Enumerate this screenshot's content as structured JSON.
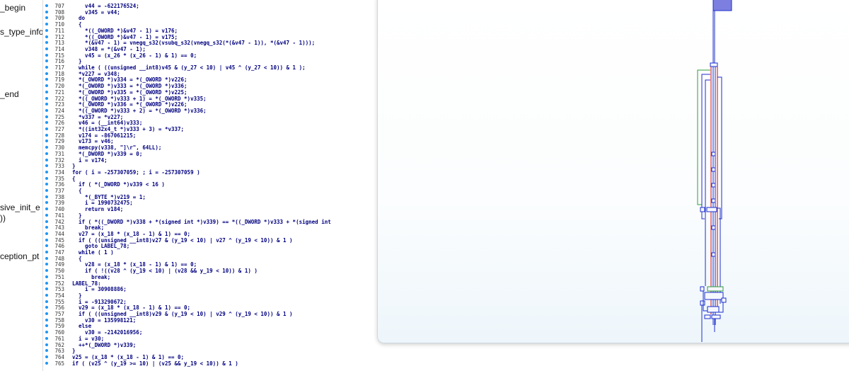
{
  "function_list": [
    {
      "label": "_begin"
    },
    {
      "label": "s_type_info"
    },
    {
      "label": "_end"
    },
    {
      "label": "sive_init_e"
    },
    {
      "label": "))"
    },
    {
      "label": "ception_pt"
    }
  ],
  "code_lines": [
    {
      "ln": "707",
      "text": "    v44 = -622176524;"
    },
    {
      "ln": "708",
      "text": "    v345 = v44;"
    },
    {
      "ln": "709",
      "text": "  do"
    },
    {
      "ln": "710",
      "text": "  {"
    },
    {
      "ln": "711",
      "text": "    *((_OWORD *)&v47 - 1) = v176;"
    },
    {
      "ln": "712",
      "text": "    *((_OWORD *)&v47 - 1) = v175;"
    },
    {
      "ln": "713",
      "text": "    *(&v47 - 1) = vnegq_s32(vsubq_s32(vnegq_s32(*(&v47 - 1)), *(&v47 - 1)));"
    },
    {
      "ln": "714",
      "text": "    v348 = *(&v47 - 1);"
    },
    {
      "ln": "715",
      "text": "    v45 = (x_26 * (x_26 - 1) & 1) == 0;"
    },
    {
      "ln": "716",
      "text": "  }"
    },
    {
      "ln": "717",
      "text": "  while ( ((unsigned __int8)v45 & (y_27 < 10) | v45 ^ (y_27 < 10)) & 1 );"
    },
    {
      "ln": "718",
      "text": "  *v227 = v348;"
    },
    {
      "ln": "719",
      "text": "  *(_OWORD *)v334 = *(_OWORD *)v226;"
    },
    {
      "ln": "720",
      "text": "  *(_OWORD *)v333 = *(_OWORD *)v336;"
    },
    {
      "ln": "721",
      "text": "  *(_OWORD *)v335 = *(_OWORD *)v225;"
    },
    {
      "ln": "722",
      "text": "  *((_OWORD *)v333 + 1) = *(_OWORD *)v335;"
    },
    {
      "ln": "723",
      "text": "  *(_OWORD *)v336 = *(_OWORD *)v226;"
    },
    {
      "ln": "724",
      "text": "  *((_OWORD *)v333 + 2) = *(_OWORD *)v336;"
    },
    {
      "ln": "725",
      "text": "  *v337 = *v227;"
    },
    {
      "ln": "726",
      "text": "  v46 = (__int64)v333;"
    },
    {
      "ln": "727",
      "text": "  *((int32x4_t *)v333 + 3) = *v337;"
    },
    {
      "ln": "728",
      "text": "  v174 = -867061215;"
    },
    {
      "ln": "729",
      "text": "  v173 = v46;"
    },
    {
      "ln": "730",
      "text": "  memcpy(v338, \"]\\r\", 64LL);"
    },
    {
      "ln": "731",
      "text": "  *(_DWORD *)v339 = 0;"
    },
    {
      "ln": "732",
      "text": "  i = v174;"
    },
    {
      "ln": "733",
      "text": "}"
    },
    {
      "ln": "734",
      "text": "for ( i = -257307059; ; i = -257307059 )"
    },
    {
      "ln": "735",
      "text": "{"
    },
    {
      "ln": "736",
      "text": "  if ( *(_DWORD *)v339 < 16 )"
    },
    {
      "ln": "737",
      "text": "  {"
    },
    {
      "ln": "738",
      "text": "    *(_BYTE *)v219 = 1;"
    },
    {
      "ln": "739",
      "text": "    i = 1990732475;"
    },
    {
      "ln": "740",
      "text": "    return v184;"
    },
    {
      "ln": "741",
      "text": "  }"
    },
    {
      "ln": "742",
      "text": "  if ( *((_DWORD *)v338 + *(signed int *)v339) == *((_DWORD *)v333 + *(signed int"
    },
    {
      "ln": "743",
      "text": "    break;"
    },
    {
      "ln": "744",
      "text": "  v27 = (x_18 * (x_18 - 1) & 1) == 0;"
    },
    {
      "ln": "745",
      "text": "  if ( ((unsigned __int8)v27 & (y_19 < 10) | v27 ^ (y_19 < 10)) & 1 )"
    },
    {
      "ln": "746",
      "text": "    goto LABEL_78;"
    },
    {
      "ln": "747",
      "text": "  while ( 1 )"
    },
    {
      "ln": "748",
      "text": "  {"
    },
    {
      "ln": "749",
      "text": "    v28 = (x_18 * (x_18 - 1) & 1) == 0;"
    },
    {
      "ln": "750",
      "text": "    if ( !((v28 ^ (y_19 < 10) | (v28 && y_19 < 10)) & 1) )"
    },
    {
      "ln": "751",
      "text": "      break;"
    },
    {
      "ln": "752",
      "text": "LABEL_78:"
    },
    {
      "ln": "753",
      "text": "    i = 30908886;"
    },
    {
      "ln": "754",
      "text": "  }"
    },
    {
      "ln": "755",
      "text": "  i = -913290672;"
    },
    {
      "ln": "756",
      "text": "  v29 = (x_18 * (x_18 - 1) & 1) == 0;"
    },
    {
      "ln": "757",
      "text": "  if ( ((unsigned __int8)v29 & (y_19 < 10) | v29 ^ (y_19 < 10)) & 1 )"
    },
    {
      "ln": "758",
      "text": "    v30 = 135998121;"
    },
    {
      "ln": "759",
      "text": "  else"
    },
    {
      "ln": "760",
      "text": "    v30 = -2142016956;"
    },
    {
      "ln": "761",
      "text": "  i = v30;"
    },
    {
      "ln": "762",
      "text": "  ++*(_DWORD *)v339;"
    },
    {
      "ln": "763",
      "text": "}"
    },
    {
      "ln": "764",
      "text": "v25 = (x_18 * (x_18 - 1) & 1) == 0;"
    },
    {
      "ln": "765",
      "text": "if ( (v25 ^ (y_19 >= 10) | (v25 && y_19 < 10)) & 1 )"
    }
  ],
  "colors": {
    "code_text": "#000080",
    "line_number": "#333333",
    "bullet": "#2196f3",
    "graph_window_bg": "#ffffff",
    "graph_edge_blue": "#1c2fcc",
    "graph_edge_red": "#e03030",
    "graph_edge_green": "#2e9e3a",
    "graph_node_fill": "#f5f7ff"
  }
}
